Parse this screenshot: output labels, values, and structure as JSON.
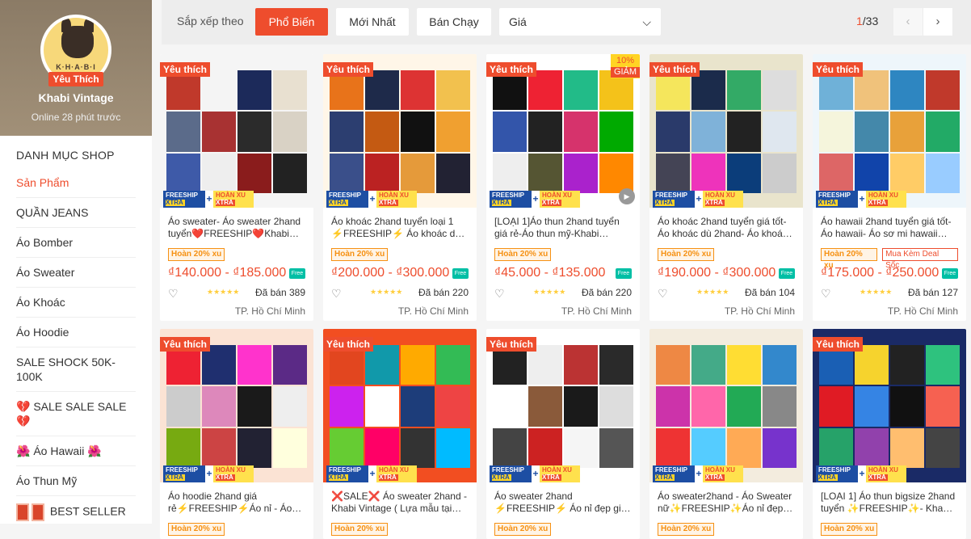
{
  "shop": {
    "avatar_brand": "K·H·A·B·I",
    "favorite_badge": "Yêu Thích",
    "name": "Khabi Vintage",
    "online_status": "Online 28 phút trước"
  },
  "sidebar": {
    "title": "DANH MỤC SHOP",
    "items": [
      {
        "label": "Sản Phẩm",
        "active": true
      },
      {
        "label": "QUẦN JEANS"
      },
      {
        "label": "Áo Bomber"
      },
      {
        "label": "Áo Sweater"
      },
      {
        "label": "Áo Khoác"
      },
      {
        "label": "Áo Hoodie"
      },
      {
        "label": "SALE SHOCK 50K-100K"
      },
      {
        "label": "💔 SALE SALE SALE 💔"
      },
      {
        "label": "🌺 Áo Hawaii 🌺"
      },
      {
        "label": "Áo Thun Mỹ"
      },
      {
        "label": "BEST SELLER"
      }
    ]
  },
  "sortbar": {
    "label": "Sắp xếp theo",
    "popular": "Phổ Biến",
    "newest": "Mới Nhất",
    "best_selling": "Bán Chạy",
    "price": "Giá",
    "page_current": "1",
    "page_total": "/33",
    "prev_icon": "‹",
    "next_icon": "›"
  },
  "labels": {
    "favorite": "Yêu thích",
    "freeship": "FREESHIP",
    "xtra": "XTRA",
    "hoanxu": "HOÀN XU",
    "hoan20": "Hoàn 20% xu",
    "combo": "Mua Kèm Deal Sốc",
    "free": "Free",
    "heart": "♡",
    "stars": "★★★★★",
    "discount_pct": "10%",
    "discount_word": "GIẢM"
  },
  "colors": {
    "accent": "#ee4d2d",
    "freeship": "#1d4ea3",
    "xtra": "#ffd424"
  },
  "products": [
    {
      "name": "Áo sweater- Áo sweater 2hand tuyển❤️FREESHIP❤️Khabi…",
      "price": "₫140.000 - ₫185.000",
      "sold": "Đã bán 389",
      "location": "TP. Hồ Chí Minh",
      "favorite": true
    },
    {
      "name": "Áo khoác 2hand tuyển loại 1 ⚡FREESHIP⚡ Áo khoác d…",
      "price": "₫200.000 - ₫300.000",
      "sold": "Đã bán 220",
      "location": "TP. Hồ Chí Minh",
      "favorite": true
    },
    {
      "name": "[LOẠI 1]Áo thun 2hand tuyển giá rẻ-Áo thun mỹ-Khabi…",
      "price": "₫45.000 - ₫135.000",
      "sold": "Đã bán 220",
      "location": "TP. Hồ Chí Minh",
      "favorite": true,
      "discount": true,
      "video": true
    },
    {
      "name": "Áo khoác 2hand tuyển giá tốt- Áo khoác dù 2hand- Áo khoá…",
      "price": "₫190.000 - ₫300.000",
      "sold": "Đã bán 104",
      "location": "TP. Hồ Chí Minh",
      "favorite": true
    },
    {
      "name": "Áo hawaii 2hand tuyển giá tốt- Áo hawaii- Áo sơ mi hawaii…",
      "price": "₫175.000 - ₫250.000",
      "sold": "Đã bán 127",
      "location": "TP. Hồ Chí Minh",
      "favorite": true,
      "combo": true
    },
    {
      "name": "Áo hoodie 2hand giá rẻ⚡FREESHIP⚡Áo nỉ - Áo…",
      "favorite": true
    },
    {
      "name": "❌SALE❌ Áo sweater 2hand - Khabi Vintage ( Lựa mẫu tại…",
      "favorite": true
    },
    {
      "name": "Áo sweater 2hand ⚡FREESHIP⚡ Áo nỉ đẹp gi…",
      "favorite": true
    },
    {
      "name": "Áo sweater2hand - Áo Sweater nữ✨FREESHIP✨Áo nỉ đẹp…",
      "favorite": false
    },
    {
      "name": "[LOẠI 1] Áo thun bigsize 2hand tuyển ✨FREESHIP✨- Kha…",
      "favorite": true
    }
  ]
}
